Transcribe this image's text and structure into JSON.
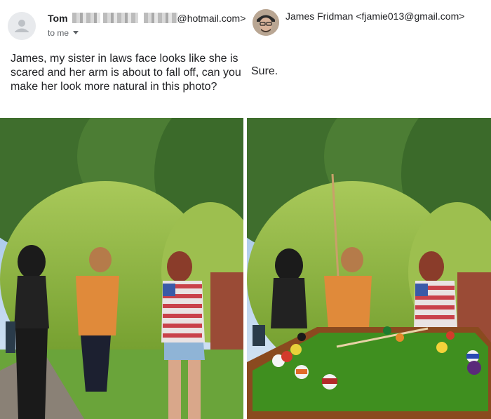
{
  "email_left": {
    "sender_name": "Tom",
    "sender_email_domain": "@hotmail.com>",
    "recipient_label": "to me",
    "message": "James, my sister in laws face looks like she is scared and her arm is about to fall off, can you make her look more natural in this photo?"
  },
  "email_right": {
    "sender_name": "James Fridman",
    "sender_email": "<fjamie013@gmail.com>",
    "message": "Sure."
  },
  "icons": {
    "left_avatar": "person-icon",
    "right_avatar": "profile-photo",
    "recipient_dropdown": "caret-down-icon"
  },
  "colors": {
    "text_primary": "#202124",
    "text_secondary": "#5f6368",
    "pool_felt": "#3f8f1f",
    "pool_rail": "#8a4a1f"
  }
}
